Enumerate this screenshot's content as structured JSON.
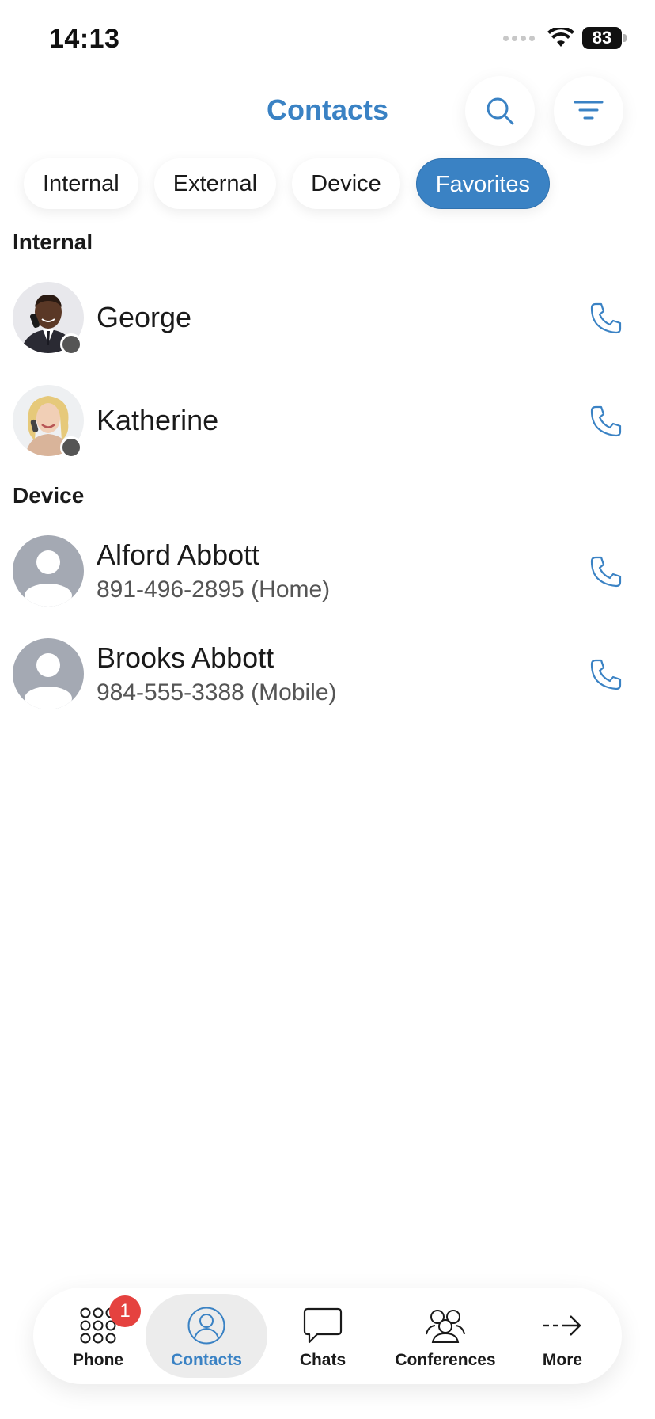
{
  "status_bar": {
    "time": "14:13",
    "battery": "83"
  },
  "header": {
    "title": "Contacts"
  },
  "filters": [
    {
      "label": "Internal",
      "active": false
    },
    {
      "label": "External",
      "active": false
    },
    {
      "label": "Device",
      "active": false
    },
    {
      "label": "Favorites",
      "active": true
    }
  ],
  "sections": {
    "internal": {
      "title": "Internal",
      "contacts": [
        {
          "name": "George",
          "presence": "offline"
        },
        {
          "name": "Katherine",
          "presence": "offline"
        }
      ]
    },
    "device": {
      "title": "Device",
      "contacts": [
        {
          "name": "Alford Abbott",
          "number": "891-496-2895 (Home)"
        },
        {
          "name": "Brooks Abbott",
          "number": "984-555-3388 (Mobile)"
        }
      ]
    }
  },
  "nav": {
    "items": [
      {
        "label": "Phone",
        "icon": "dialpad-icon",
        "badge": "1"
      },
      {
        "label": "Contacts",
        "icon": "person-icon",
        "active": true
      },
      {
        "label": "Chats",
        "icon": "chat-bubble-icon"
      },
      {
        "label": "Conferences",
        "icon": "group-icon"
      },
      {
        "label": "More",
        "icon": "arrow-right-icon"
      }
    ]
  },
  "colors": {
    "accent": "#3a82c4",
    "badge": "#e5423f",
    "presence_offline": "#555555",
    "placeholder_avatar": "#a4a9b3"
  }
}
